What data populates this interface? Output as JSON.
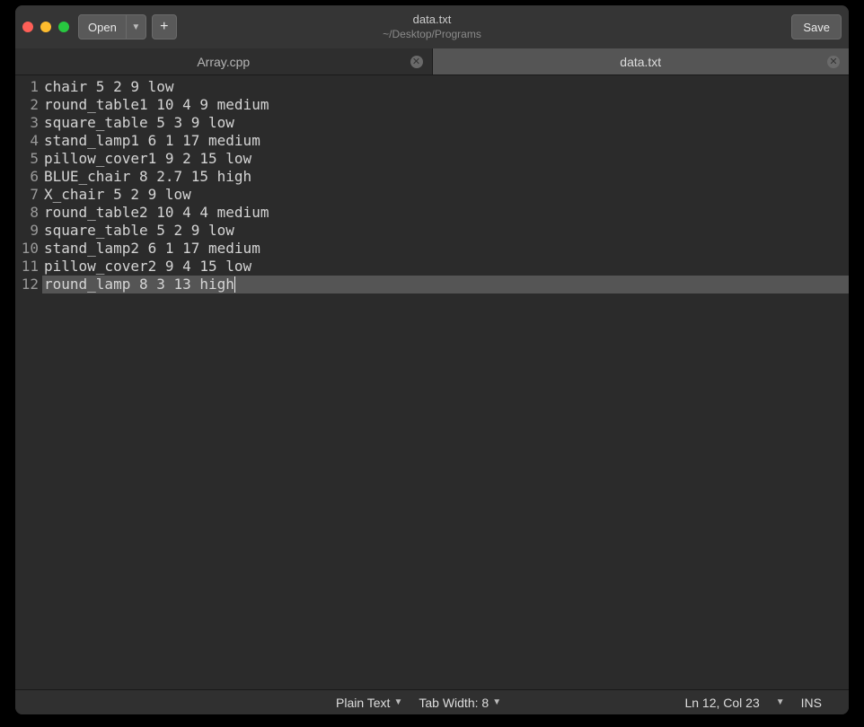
{
  "window": {
    "title": "data.txt",
    "subtitle": "~/Desktop/Programs",
    "open_label": "Open",
    "save_label": "Save"
  },
  "tabs": [
    {
      "label": "Array.cpp",
      "active": false
    },
    {
      "label": "data.txt",
      "active": true
    }
  ],
  "editor": {
    "lines": [
      "chair 5 2 9 low",
      "round_table1 10 4 9 medium",
      "square_table 5 3 9 low",
      "stand_lamp1 6 1 17 medium",
      "pillow_cover1 9 2 15 low",
      "BLUE_chair 8 2.7 15 high",
      "X_chair 5 2 9 low",
      "round_table2 10 4 4 medium",
      "square_table 5 2 9 low",
      "stand_lamp2 6 1 17 medium",
      "pillow_cover2 9 4 15 low",
      "round_lamp 8 3 13 high"
    ],
    "cursor_line": 12,
    "cursor_col": 23
  },
  "statusbar": {
    "syntax": "Plain Text",
    "tab_width": "Tab Width: 8",
    "position": "Ln 12, Col 23",
    "mode": "INS"
  }
}
